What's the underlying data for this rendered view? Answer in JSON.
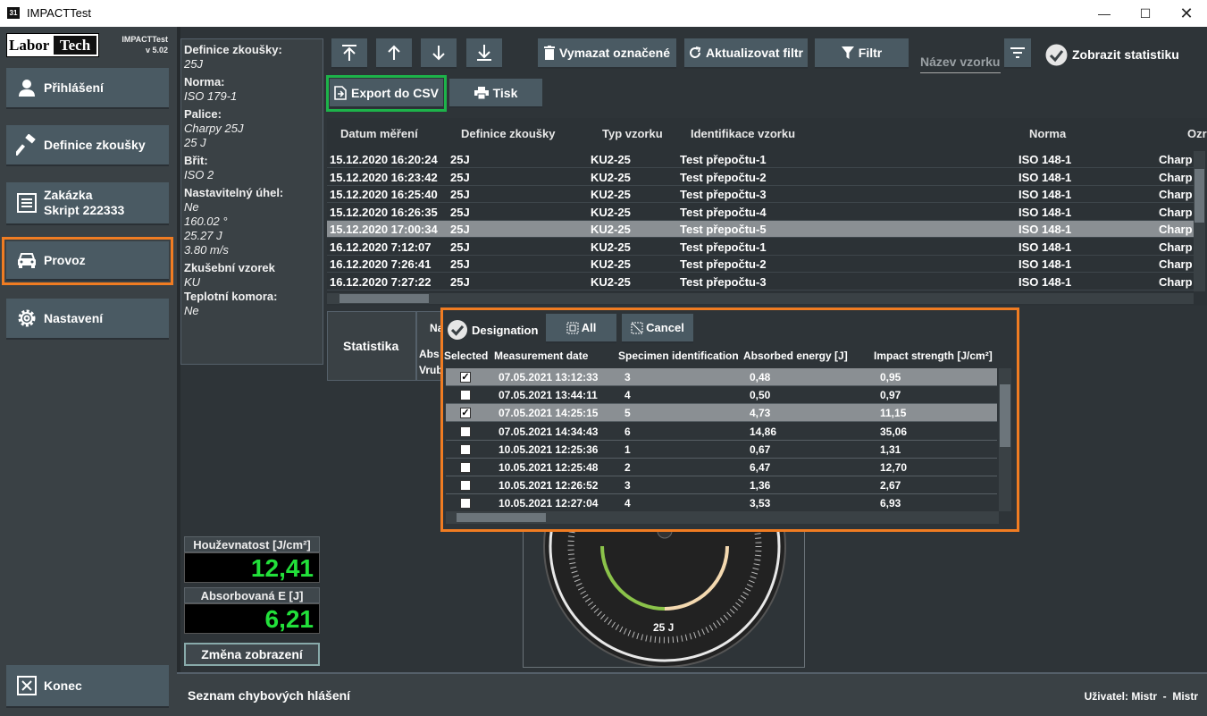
{
  "window": {
    "title": "IMPACTTest",
    "controls": [
      "minimize",
      "maximize",
      "close"
    ]
  },
  "sidebar": {
    "logo_left": "Labor",
    "logo_right": "Tech",
    "app_name": "IMPACTTest",
    "version": "v 5.02",
    "items": [
      {
        "label": "Přihlášení",
        "icon": "user-icon"
      },
      {
        "label": "Definice zkoušky",
        "icon": "hammer-icon"
      },
      {
        "label": "Zakázka",
        "sub": "Skript 222333",
        "icon": "list-icon"
      },
      {
        "label": "Provoz",
        "icon": "car-icon",
        "active": true
      },
      {
        "label": "Nastavení",
        "icon": "gear-icon"
      }
    ],
    "exit_label": "Konec"
  },
  "info": {
    "definice_label": "Definice zkoušky:",
    "definice_value": "25J",
    "norma_label": "Norma:",
    "norma_value": "ISO 179-1",
    "palice_label": "Palice:",
    "palice_value1": "Charpy 25J",
    "palice_value2": "25 J",
    "brit_label": "Břit:",
    "brit_value": "ISO 2",
    "uhel_label": "Nastavitelný úhel:",
    "uhel_v1": "Ne",
    "uhel_v2": "160.02 °",
    "uhel_v3": "25.27 J",
    "uhel_v4": "3.80 m/s",
    "vzorek_label": "Zkušební vzorek",
    "vzorek_value": "KU",
    "komora_label": "Teplotní komora:",
    "komora_value": "Ne"
  },
  "displays": {
    "toughness_label": "Houževnatost [J/cm²]",
    "toughness_value": "12,41",
    "energy_label": "Absorbovaná E [J]",
    "energy_value": "6,21",
    "change_view": "Změna zobrazení"
  },
  "toolbar": {
    "delete_marked": "Vymazat označené",
    "refresh_filter": "Aktualizovat filtr",
    "filter": "Filtr",
    "sample_name_placeholder": "Název vzorku",
    "show_stats": "Zobrazit statistiku",
    "export_csv": "Export do CSV",
    "print": "Tisk"
  },
  "grid": {
    "headers": [
      "Datum měření",
      "Definice zkoušky",
      "Typ vzorku",
      "Identifikace vzorku",
      "Norma",
      "Ozr"
    ],
    "rows": [
      {
        "date": "15.12.2020 16:20:24",
        "def": "25J",
        "type": "KU2-25",
        "id": "Test přepočtu-1",
        "norm": "ISO 148-1",
        "ozn": "Charp"
      },
      {
        "date": "15.12.2020 16:23:42",
        "def": "25J",
        "type": "KU2-25",
        "id": "Test přepočtu-2",
        "norm": "ISO 148-1",
        "ozn": "Charp"
      },
      {
        "date": "15.12.2020 16:25:40",
        "def": "25J",
        "type": "KU2-25",
        "id": "Test přepočtu-3",
        "norm": "ISO 148-1",
        "ozn": "Charp"
      },
      {
        "date": "15.12.2020 16:26:35",
        "def": "25J",
        "type": "KU2-25",
        "id": "Test přepočtu-4",
        "norm": "ISO 148-1",
        "ozn": "Charp"
      },
      {
        "date": "15.12.2020 17:00:34",
        "def": "25J",
        "type": "KU2-25",
        "id": "Test přepočtu-5",
        "norm": "ISO 148-1",
        "ozn": "Charp"
      },
      {
        "date": "16.12.2020 7:12:07",
        "def": "25J",
        "type": "KU2-25",
        "id": "Test přepočtu-1",
        "norm": "ISO 148-1",
        "ozn": "Charp"
      },
      {
        "date": "16.12.2020 7:26:41",
        "def": "25J",
        "type": "KU2-25",
        "id": "Test přepočtu-2",
        "norm": "ISO 148-1",
        "ozn": "Charp"
      },
      {
        "date": "16.12.2020 7:27:22",
        "def": "25J",
        "type": "KU2-25",
        "id": "Test přepočtu-3",
        "norm": "ISO 148-1",
        "ozn": "Charp"
      }
    ],
    "selected_row": 4
  },
  "stats": {
    "title": "Statistika",
    "col_na": "Na",
    "row1": "Abs",
    "row2": "Vrub"
  },
  "popup": {
    "designation": "Designation",
    "all": "All",
    "cancel": "Cancel",
    "headers": [
      "Selected",
      "Measurement date",
      "Specimen identification",
      "Absorbed energy [J]",
      "Impact strength [J/cm²]"
    ],
    "rows": [
      {
        "checked": true,
        "date": "07.05.2021 13:12:33",
        "spec": "3",
        "energy": "0,48",
        "strength": "0,95",
        "sel": true
      },
      {
        "checked": false,
        "date": "07.05.2021 13:44:11",
        "spec": "4",
        "energy": "0,50",
        "strength": "0,97",
        "sel": false
      },
      {
        "checked": true,
        "date": "07.05.2021 14:25:15",
        "spec": "5",
        "energy": "4,73",
        "strength": "11,15",
        "sel": true
      },
      {
        "checked": false,
        "date": "07.05.2021 14:34:43",
        "spec": "6",
        "energy": "14,86",
        "strength": "35,06",
        "sel": false
      },
      {
        "checked": false,
        "date": "10.05.2021 12:25:36",
        "spec": "1",
        "energy": "0,67",
        "strength": "1,31",
        "sel": false
      },
      {
        "checked": false,
        "date": "10.05.2021 12:25:48",
        "spec": "2",
        "energy": "6,47",
        "strength": "12,70",
        "sel": false
      },
      {
        "checked": false,
        "date": "10.05.2021 12:26:52",
        "spec": "3",
        "energy": "1,36",
        "strength": "2,67",
        "sel": false
      },
      {
        "checked": false,
        "date": "10.05.2021 12:27:04",
        "spec": "4",
        "energy": "3,53",
        "strength": "6,93",
        "sel": false
      }
    ]
  },
  "gauge": {
    "label": "25 J"
  },
  "statusbar": {
    "errors": "Seznam chybových hlášení",
    "user": "Uživatel: Mistr  -  Mistr"
  },
  "colors": {
    "highlight_orange": "#f07c22",
    "highlight_green": "#1db34a",
    "digit_green": "#22e03a"
  }
}
